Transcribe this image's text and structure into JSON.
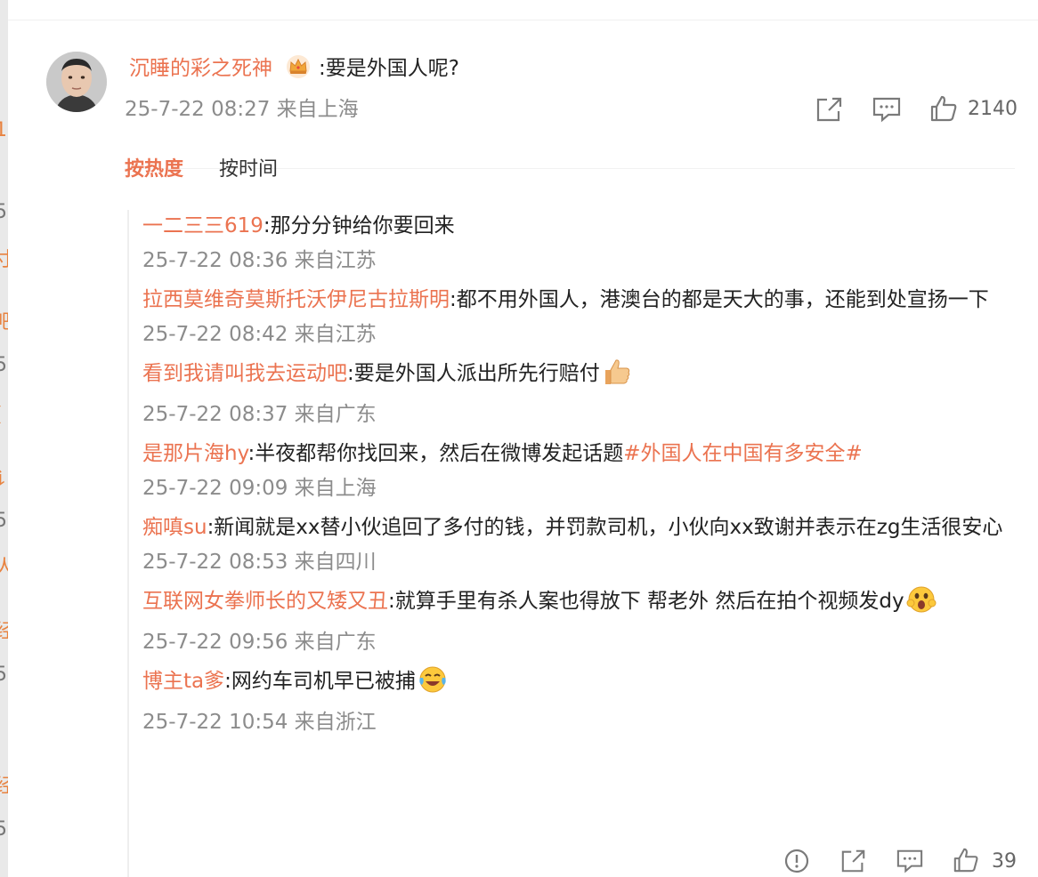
{
  "comment": {
    "user": "沉睡的彩之死神",
    "crown_icon": "crown-icon",
    "text": ":要是外国人呢?",
    "time": "25-7-22 08:27",
    "location": "来自上海",
    "like_count": "2140"
  },
  "tabs": [
    {
      "label": "按热度",
      "active": true
    },
    {
      "label": "按时间",
      "active": false
    }
  ],
  "replies": [
    {
      "user": "一二三三619",
      "text": ":那分分钟给你要回来",
      "time": "25-7-22 08:36",
      "location": "来自江苏"
    },
    {
      "user": "拉西莫维奇莫斯托沃伊尼古拉斯明",
      "text": ":都不用外国人，港澳台的都是天大的事，还能到处宣扬一下",
      "time": "25-7-22 08:42",
      "location": "来自江苏"
    },
    {
      "user": "看到我请叫我去运动吧",
      "text": ":要是外国人派出所先行赔付",
      "emoji": "thumbs-up-emoji",
      "time": "25-7-22 08:37",
      "location": "来自广东"
    },
    {
      "user": "是那片海hy",
      "text": ":半夜都帮你找回来，然后在微博发起话题",
      "topic": "#外国人在中国有多安全#",
      "time": "25-7-22 09:09",
      "location": "来自上海"
    },
    {
      "user": "痴嗔su",
      "text": ":新闻就是xx替小伙追回了多付的钱，并罚款司机，小伙向xx致谢并表示在zg生活很安心",
      "time": "25-7-22 08:53",
      "location": "来自四川"
    },
    {
      "user": "互联网女拳师长的又矮又丑",
      "text": ":就算手里有杀人案也得放下  帮老外  然后在拍个视频发dy",
      "emoji": "shocked-face-emoji",
      "time": "25-7-22 09:56",
      "location": "来自广东"
    },
    {
      "user": "博主ta爹",
      "text": ":网约车司机早已被捕",
      "emoji": "laughing-tears-emoji",
      "time": "25-7-22 10:54",
      "location": "来自浙江"
    }
  ],
  "reply_like_count": "39",
  "colors": {
    "accent": "#eb7350",
    "meta": "#8c8c8c",
    "text": "#222222"
  }
}
